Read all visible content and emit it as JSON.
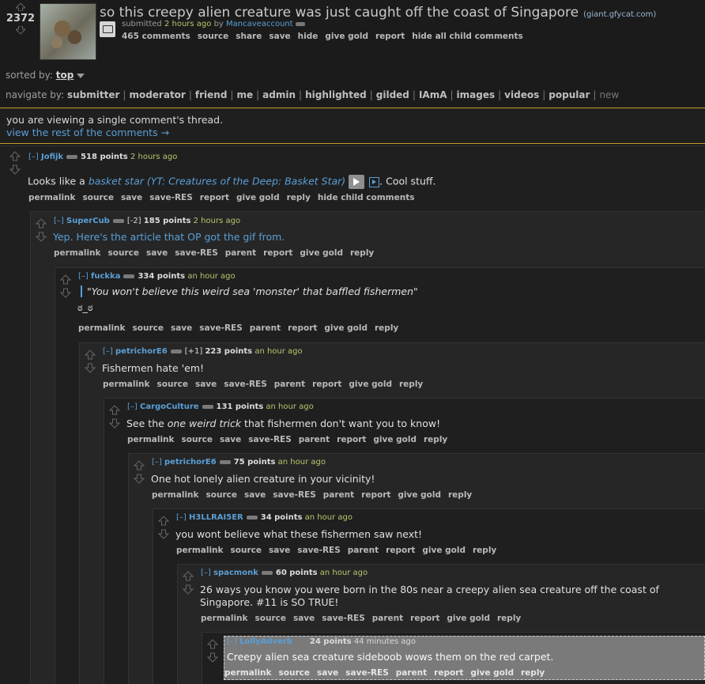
{
  "post": {
    "score": "2372",
    "title": "so this creepy alien creature was just caught off the coast of Singapore",
    "domain": "(giant.gfycat.com)",
    "tagline_prefix": "submitted",
    "tagline_time": "2 hours ago",
    "tagline_by": "by",
    "author": "Mancaveaccount",
    "buttons": [
      "465 comments",
      "source",
      "share",
      "save",
      "hide",
      "give gold",
      "report",
      "hide all child comments"
    ]
  },
  "sort": {
    "label": "sorted by:",
    "value": "top"
  },
  "navigate": {
    "label": "navigate by:",
    "items": [
      "submitter",
      "moderator",
      "friend",
      "me",
      "admin",
      "highlighted",
      "gilded",
      "IAmA",
      "images",
      "videos",
      "popular"
    ],
    "disabled": "new"
  },
  "notice": {
    "text": "you are viewing a single comment's thread.",
    "link": "view the rest of the comments →"
  },
  "comments": [
    {
      "expand": "[–]",
      "author": "Jofijk",
      "flair": "",
      "points": "518 points",
      "time": "2 hours ago",
      "body_pre": "Looks like a ",
      "body_link": "basket star (YT: Creatures of the Deep: Basket Star)",
      "body_post": ". Cool stuff.",
      "buttons": [
        "permalink",
        "source",
        "save",
        "save-RES",
        "report",
        "give gold",
        "reply",
        "hide child comments"
      ]
    },
    {
      "expand": "[–]",
      "author": "SuperCub",
      "flair": "[-2]",
      "points": "185 points",
      "time": "2 hours ago",
      "body": "Yep. Here's the article that OP got the gif from.",
      "buttons": [
        "permalink",
        "source",
        "save",
        "save-RES",
        "parent",
        "report",
        "give gold",
        "reply"
      ]
    },
    {
      "expand": "[–]",
      "author": "fuckka",
      "flair": "",
      "points": "334 points",
      "time": "an hour ago",
      "body": "\"You won't believe this weird sea 'monster' that baffled fishermen\"",
      "body2": "ಠ_ಠ",
      "buttons": [
        "permalink",
        "source",
        "save",
        "save-RES",
        "parent",
        "report",
        "give gold",
        "reply"
      ]
    },
    {
      "expand": "[–]",
      "author": "petrichorE6",
      "flair": "[+1]",
      "points": "223 points",
      "time": "an hour ago",
      "body": "Fishermen hate 'em!",
      "buttons": [
        "permalink",
        "source",
        "save",
        "save-RES",
        "parent",
        "report",
        "give gold",
        "reply"
      ]
    },
    {
      "expand": "[–]",
      "author": "CargoCulture",
      "flair": "",
      "points": "131 points",
      "time": "an hour ago",
      "body_pre": "See the ",
      "body_em": "one weird trick",
      "body_post": " that fishermen don't want you to know!",
      "buttons": [
        "permalink",
        "source",
        "save",
        "save-RES",
        "parent",
        "report",
        "give gold",
        "reply"
      ]
    },
    {
      "expand": "[–]",
      "author": "petrichorE6",
      "flair": "",
      "points": "75 points",
      "time": "an hour ago",
      "body": "One hot lonely alien creature in your vicinity!",
      "buttons": [
        "permalink",
        "source",
        "save",
        "save-RES",
        "parent",
        "report",
        "give gold",
        "reply"
      ]
    },
    {
      "expand": "[–]",
      "author": "H3LLRAI5ER",
      "flair": "",
      "points": "34 points",
      "time": "an hour ago",
      "body": "you wont believe what these fishermen saw next!",
      "buttons": [
        "permalink",
        "source",
        "save",
        "save-RES",
        "parent",
        "report",
        "give gold",
        "reply"
      ]
    },
    {
      "expand": "[–]",
      "author": "spacmonk",
      "flair": "",
      "points": "60 points",
      "time": "an hour ago",
      "body": "26 ways you know you were born in the 80s near a creepy alien sea creature off the coast of",
      "body2": "Singapore. #11 is SO TRUE!",
      "buttons": [
        "permalink",
        "source",
        "save",
        "save-RES",
        "parent",
        "report",
        "give gold",
        "reply"
      ]
    },
    {
      "expand": "[–]",
      "author": "LollyAdverb",
      "flair": "",
      "points": "24 points",
      "time": "44 minutes ago",
      "body": "Creepy alien sea creature sideboob wows them on the red carpet.",
      "buttons": [
        "permalink",
        "source",
        "save",
        "save-RES",
        "parent",
        "report",
        "give gold",
        "reply"
      ]
    }
  ],
  "colors": {
    "background": "#1b1b1b",
    "link": "#5a9fd6",
    "time": "#b8c56b",
    "notice_border": "#c59c2b"
  }
}
